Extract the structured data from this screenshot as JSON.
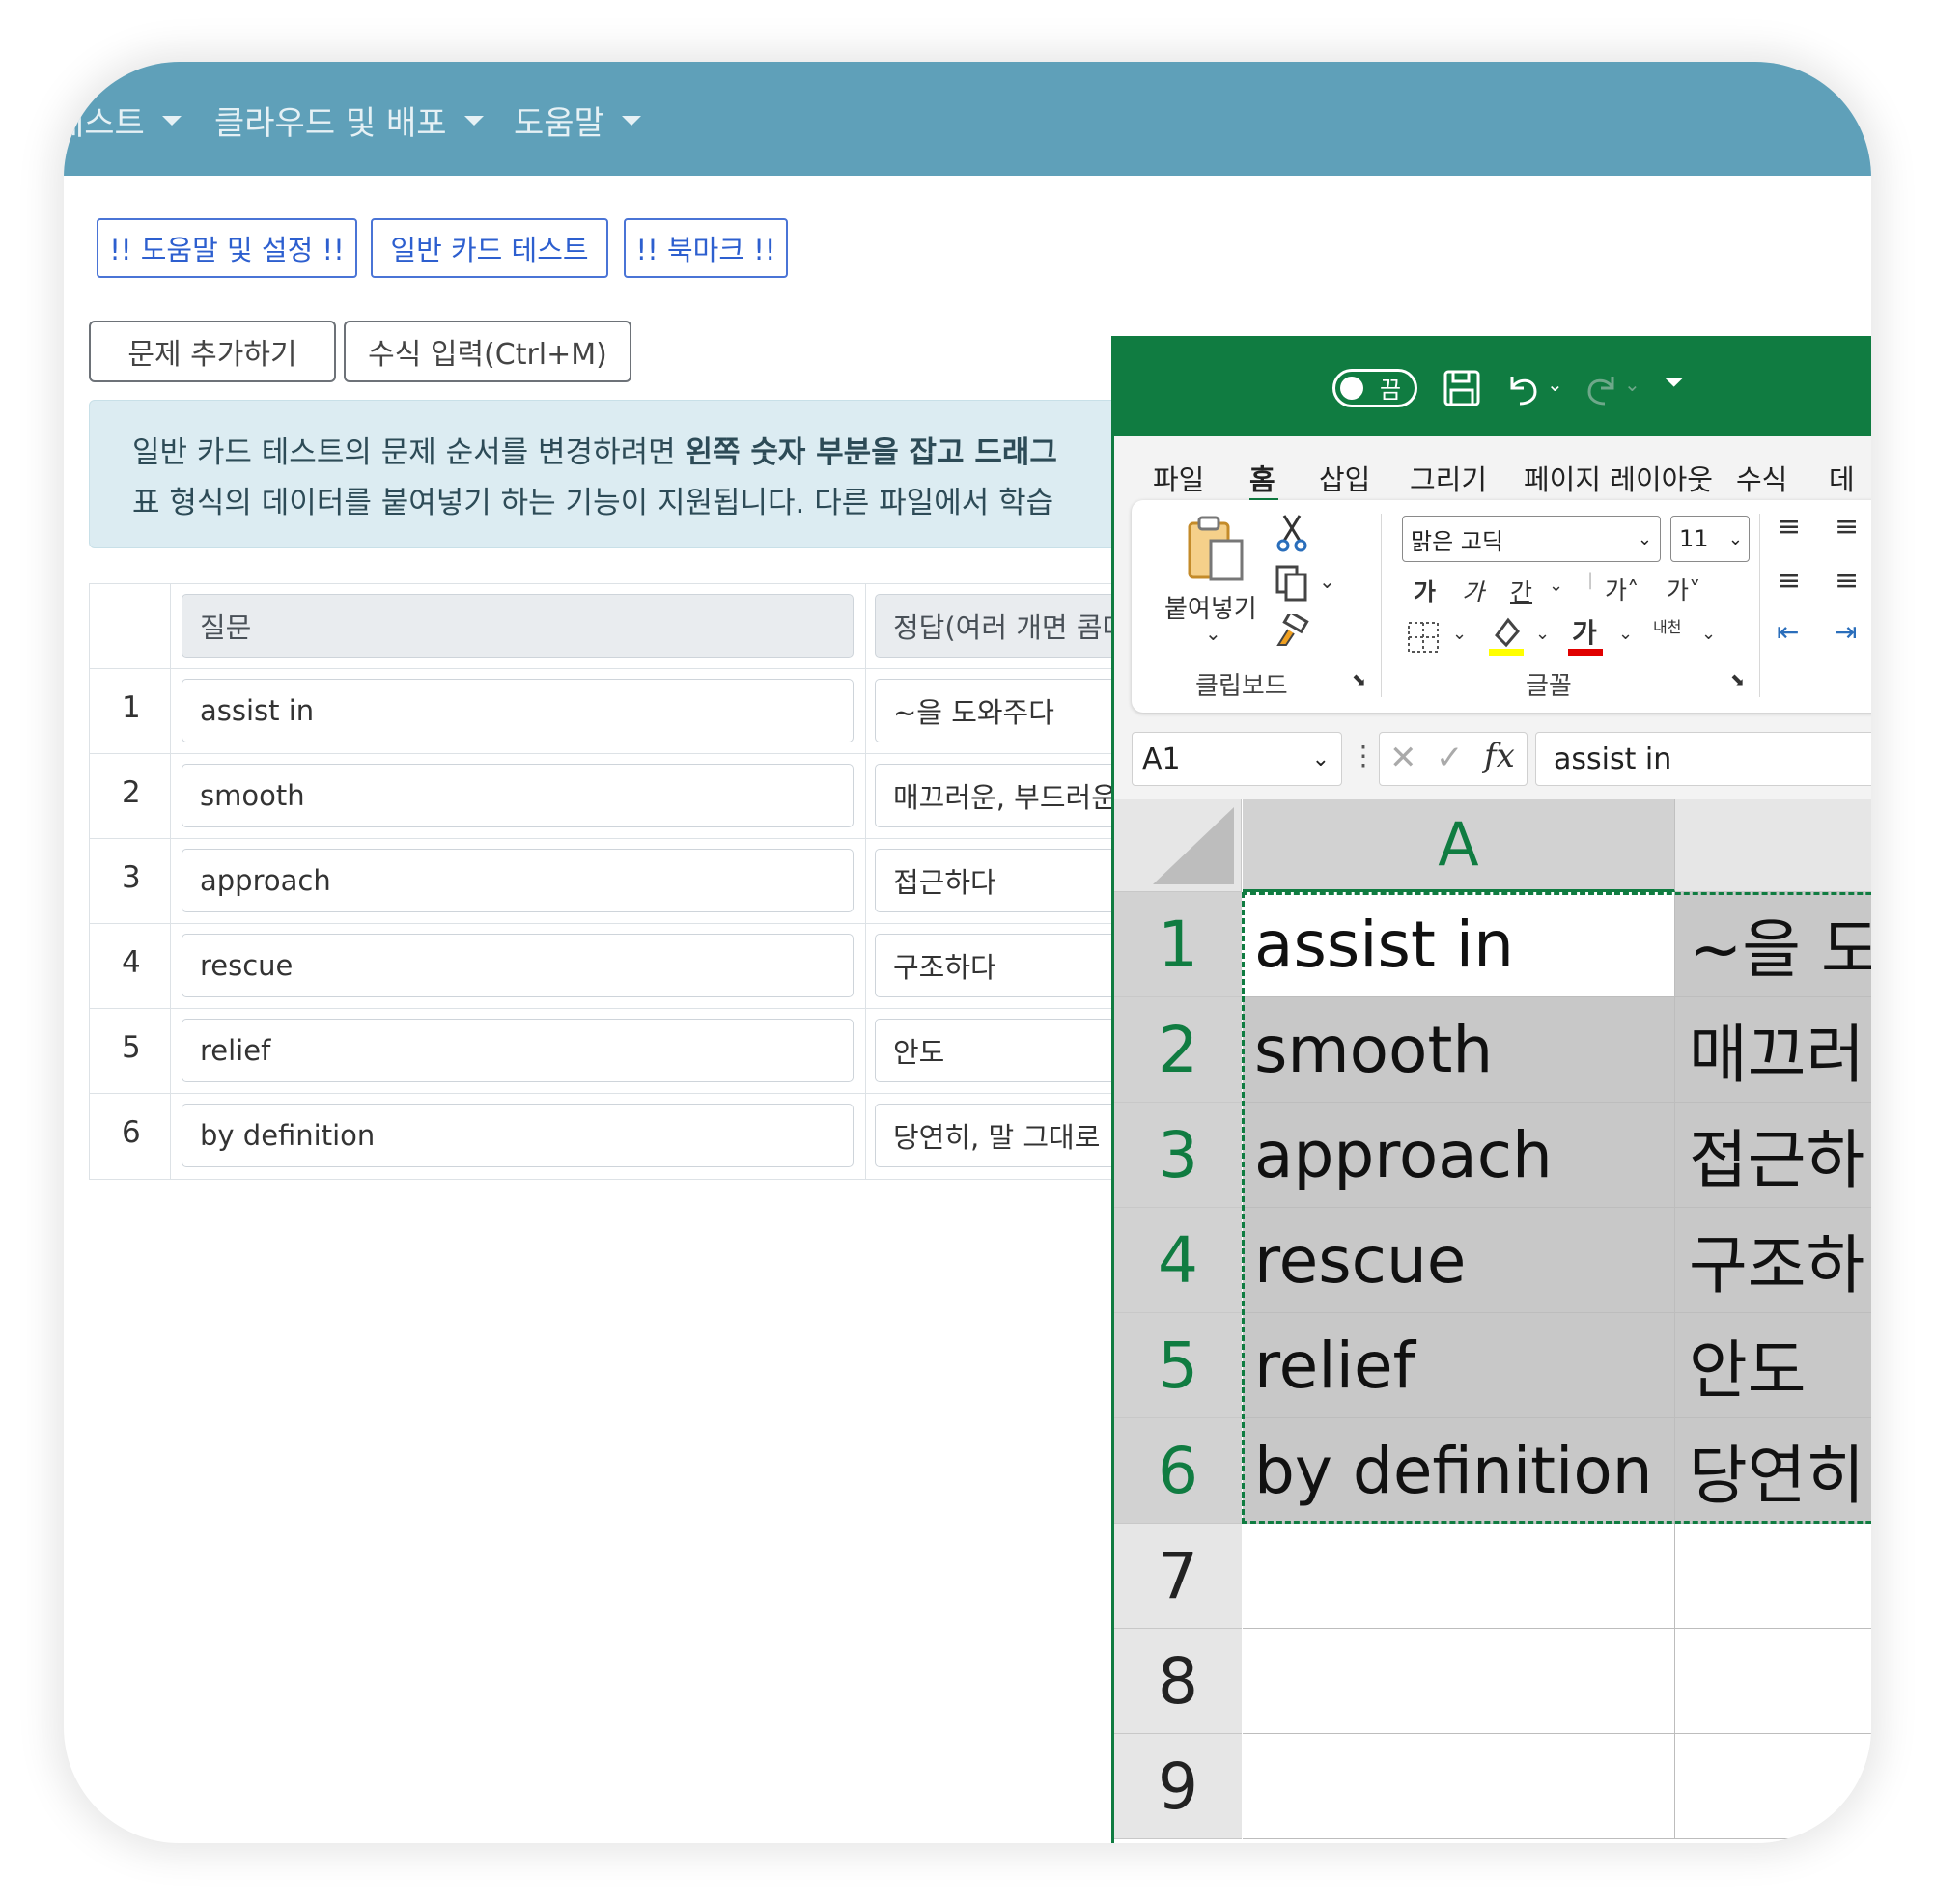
{
  "nav": {
    "items": [
      {
        "label": "테스트"
      },
      {
        "label": "클라우드 및 배포"
      },
      {
        "label": "도움말"
      }
    ]
  },
  "toolbar": {
    "help_settings": "!! 도움말 및 설정 !!",
    "card_test": "일반 카드 테스트",
    "bookmark": "!! 북마크 !!",
    "add_question": "문제 추가하기",
    "formula_input": "수식 입력(Ctrl+M)"
  },
  "info": {
    "line1_a": "일반 카드 테스트의 문제 순서를 변경하려면 ",
    "line1_b": "왼쪽 숫자 부분을 잡고 드래그",
    "line2": "표 형식의 데이터를 붙여넣기 하는 기능이 지원됩니다. 다른 파일에서 학습"
  },
  "table": {
    "headers": {
      "question": "질문",
      "answer": "정답(여러 개면 콤마"
    },
    "rows": [
      {
        "num": "1",
        "question": "assist in",
        "answer": "~을 도와주다"
      },
      {
        "num": "2",
        "question": "smooth",
        "answer": "매끄러운, 부드러운"
      },
      {
        "num": "3",
        "question": "approach",
        "answer": "접근하다"
      },
      {
        "num": "4",
        "question": "rescue",
        "answer": "구조하다"
      },
      {
        "num": "5",
        "question": "relief",
        "answer": "안도"
      },
      {
        "num": "6",
        "question": "by definition",
        "answer": "당연히, 말 그대로"
      }
    ]
  },
  "excel": {
    "autosave_label": "끔",
    "menu": [
      "파일",
      "홈",
      "삽입",
      "그리기",
      "페이지 레이아웃",
      "수식",
      "데"
    ],
    "active_menu": "홈",
    "ribbon": {
      "paste": "붙여넣기",
      "clipboard": "클립보드",
      "font_group": "글꼴",
      "font_name": "맑은 고딕",
      "font_size": "11",
      "bold": "가",
      "italic": "가",
      "underline": "간",
      "grow": "가˄",
      "shrink": "가˅",
      "font_color": "가",
      "phonetic": "내천"
    },
    "name_box": "A1",
    "formula": "assist in",
    "column_header": "A",
    "rows": [
      {
        "num": "1",
        "a": "assist in",
        "b": "~을 도"
      },
      {
        "num": "2",
        "a": "smooth",
        "b": "매끄러"
      },
      {
        "num": "3",
        "a": "approach",
        "b": "접근하"
      },
      {
        "num": "4",
        "a": "rescue",
        "b": "구조하"
      },
      {
        "num": "5",
        "a": "relief",
        "b": "안도"
      },
      {
        "num": "6",
        "a": "by definition",
        "b": "당연히"
      },
      {
        "num": "7",
        "a": "",
        "b": ""
      },
      {
        "num": "8",
        "a": "",
        "b": ""
      },
      {
        "num": "9",
        "a": "",
        "b": ""
      }
    ]
  },
  "colors": {
    "navbar": "#5fa0b9",
    "excel_green": "#107c41",
    "button_blue": "#2d5fcf",
    "info_bg": "#dcecf2"
  }
}
